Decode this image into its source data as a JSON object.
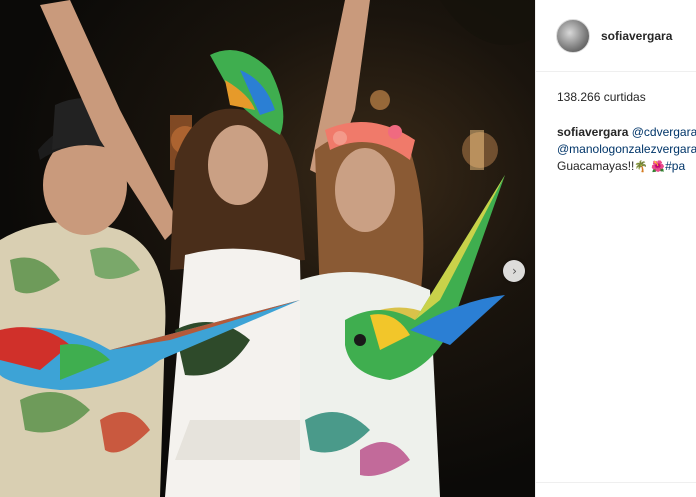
{
  "post": {
    "username": "sofiavergara",
    "likes_text": "138.266 curtidas",
    "caption": {
      "author": "sofiavergara",
      "mention_1": "@cdvergara",
      "mention_2": "@manologonzalezvergara",
      "text": "Guacamayas!!",
      "emoji_1": "🌴",
      "emoji_2": "🌺",
      "hashtag": "#pa"
    }
  },
  "photo": {
    "alt_subjects": [
      "man-in-hat",
      "woman-center",
      "woman-flower-crown",
      "macaw-parrots"
    ],
    "next_icon": "chevron-right-icon"
  },
  "colors": {
    "photo_bg": "#0b0a08",
    "mention": "#003569",
    "text": "#262626",
    "divider": "#efefef"
  }
}
